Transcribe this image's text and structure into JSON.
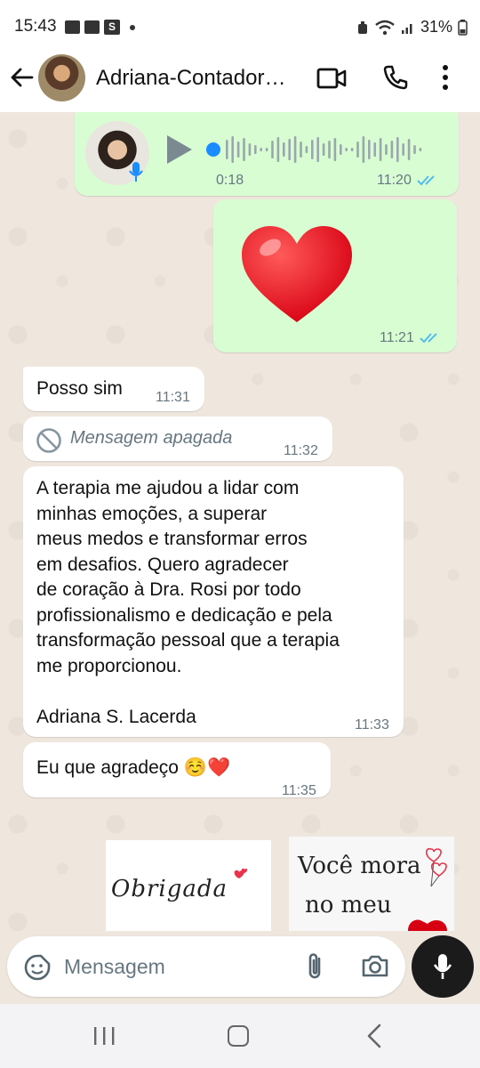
{
  "status_bar": {
    "time": "15:43",
    "battery": "31%"
  },
  "header": {
    "contact_name": "Adriana-Contador…"
  },
  "messages": [
    {
      "type": "audio",
      "direction": "outgoing",
      "duration": "0:18",
      "time": "11:20",
      "read": true
    },
    {
      "type": "emoji",
      "direction": "outgoing",
      "emoji": "❤️",
      "time": "11:21",
      "read": true
    },
    {
      "type": "text",
      "direction": "incoming",
      "text": "Posso sim",
      "time": "11:31"
    },
    {
      "type": "deleted",
      "direction": "incoming",
      "text": "Mensagem apagada",
      "time": "11:32"
    },
    {
      "type": "text",
      "direction": "incoming",
      "lines": [
        "A terapia me ajudou a lidar com",
        "minhas emoções, a superar",
        "meus medos e transformar erros",
        "em desafios. Quero agradecer",
        "de coração à Dra. Rosi por todo",
        "profissionalismo e dedicação e pela",
        "transformação pessoal que a terapia",
        "me proporcionou.",
        "",
        "Adriana S. Lacerda"
      ],
      "time": "11:33"
    },
    {
      "type": "text",
      "direction": "incoming",
      "text": "Eu que agradeço ☺️❤️",
      "time": "11:35"
    }
  ],
  "stickers": [
    {
      "text": "Obrigada"
    },
    {
      "text_line1": "Você mora",
      "text_line2": "no meu"
    }
  ],
  "input": {
    "placeholder": "Mensagem"
  },
  "colors": {
    "outgoing_bubble": "#d9fdd3",
    "incoming_bubble": "#ffffff",
    "chat_background": "#efe7de",
    "read_ticks": "#53bdeb",
    "audio_dot": "#1a8cff"
  },
  "icons": {
    "back": "arrow-left-icon",
    "video": "video-camera-icon",
    "call": "phone-icon",
    "menu": "more-vertical-icon",
    "emoji": "sticker-smiley-icon",
    "attach": "paperclip-icon",
    "camera": "camera-icon",
    "mic": "microphone-icon"
  }
}
